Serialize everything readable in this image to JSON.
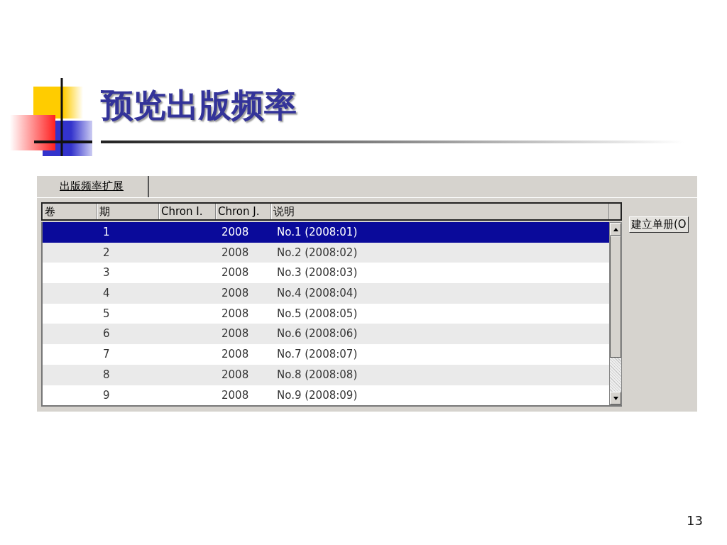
{
  "slide": {
    "title": "预览出版频率",
    "page_number": "13"
  },
  "app": {
    "tabs": [
      {
        "label": "出版频率扩展"
      }
    ],
    "table": {
      "columns": [
        "卷",
        "期",
        "Chron I.",
        "Chron J.",
        "说明"
      ],
      "rows": [
        {
          "cells": [
            "",
            "1",
            "",
            "2008",
            "No.1 (2008:01)"
          ],
          "selected": true
        },
        {
          "cells": [
            "",
            "2",
            "",
            "2008",
            "No.2 (2008:02)"
          ],
          "selected": false
        },
        {
          "cells": [
            "",
            "3",
            "",
            "2008",
            "No.3 (2008:03)"
          ],
          "selected": false
        },
        {
          "cells": [
            "",
            "4",
            "",
            "2008",
            "No.4 (2008:04)"
          ],
          "selected": false
        },
        {
          "cells": [
            "",
            "5",
            "",
            "2008",
            "No.5 (2008:05)"
          ],
          "selected": false
        },
        {
          "cells": [
            "",
            "6",
            "",
            "2008",
            "No.6 (2008:06)"
          ],
          "selected": false
        },
        {
          "cells": [
            "",
            "7",
            "",
            "2008",
            "No.7 (2008:07)"
          ],
          "selected": false
        },
        {
          "cells": [
            "",
            "8",
            "",
            "2008",
            "No.8 (2008:08)"
          ],
          "selected": false
        },
        {
          "cells": [
            "",
            "9",
            "",
            "2008",
            "No.9 (2008:09)"
          ],
          "selected": false
        }
      ]
    },
    "button": "建立单册(O"
  }
}
